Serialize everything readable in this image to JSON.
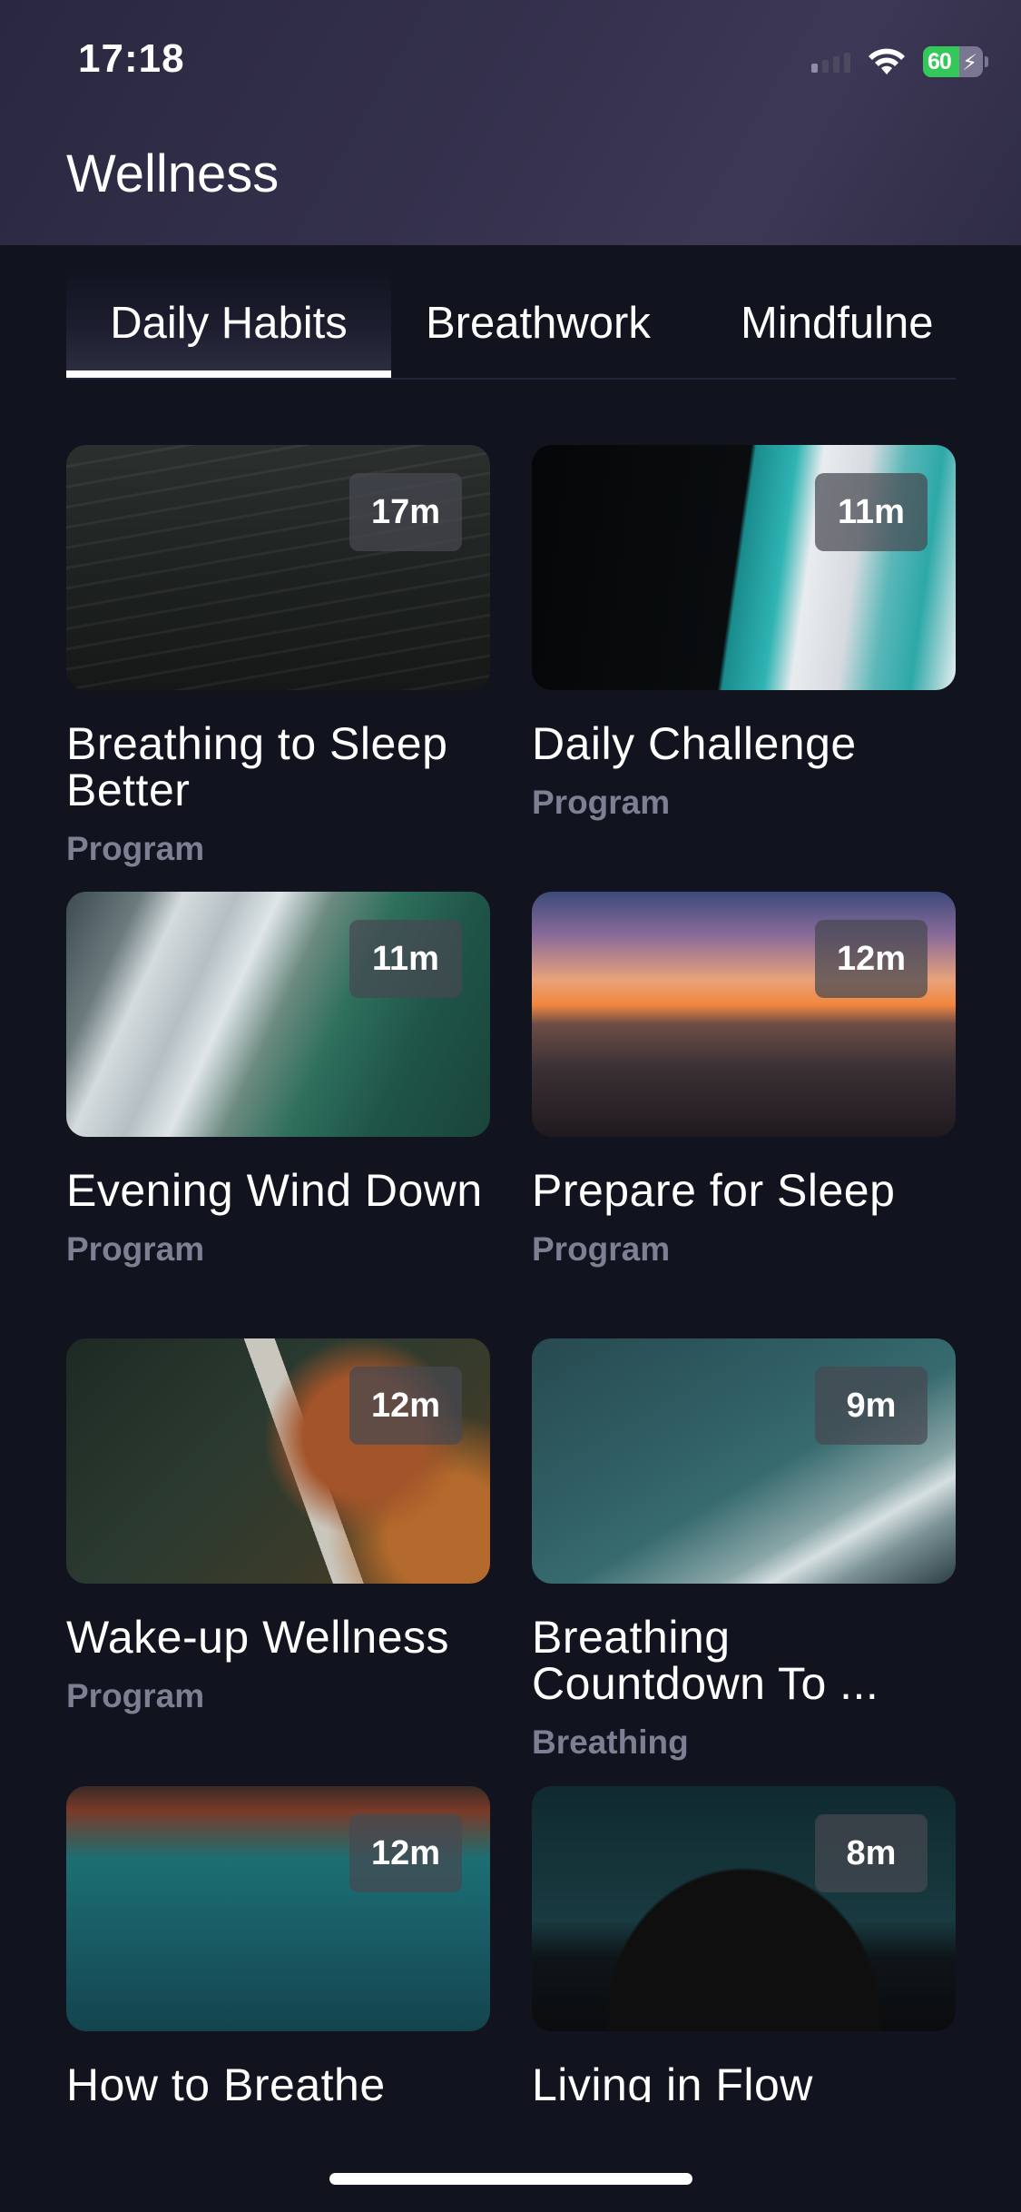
{
  "status_bar": {
    "time": "17:18",
    "battery": "60",
    "battery_level": 0.6
  },
  "header": {
    "title": "Wellness"
  },
  "tabs": [
    {
      "label": "Daily Habits",
      "active": true
    },
    {
      "label": "Breathwork",
      "active": false
    },
    {
      "label": "Mindfulne",
      "active": false
    }
  ],
  "cards": [
    {
      "title": "Breathing to Sleep Better",
      "type": "Program",
      "duration": "17m",
      "image": "dark-ocean-water"
    },
    {
      "title": "Daily Challenge",
      "type": "Program",
      "duration": "11m",
      "image": "aerial-ice-teal"
    },
    {
      "title": "Evening Wind Down",
      "type": "Program",
      "duration": "11m",
      "image": "aerial-beach-green"
    },
    {
      "title": "Prepare for Sleep",
      "type": "Program",
      "duration": "12m",
      "image": "sunset-sea"
    },
    {
      "title": "Wake-up Wellness",
      "type": "Program",
      "duration": "12m",
      "image": "aerial-autumn-forest"
    },
    {
      "title": "Breathing Countdown To ...",
      "type": "Breathing",
      "duration": "9m",
      "image": "aerial-ocean-wave"
    },
    {
      "title": "How to Breathe",
      "type": "",
      "duration": "12m",
      "image": "aerial-teal-reef"
    },
    {
      "title": "Living in Flow",
      "type": "",
      "duration": "8m",
      "image": "night-sky-hill"
    }
  ],
  "colors": {
    "background": "#11131f",
    "subtitle": "#7d8092",
    "battery_green": "#34c759"
  }
}
